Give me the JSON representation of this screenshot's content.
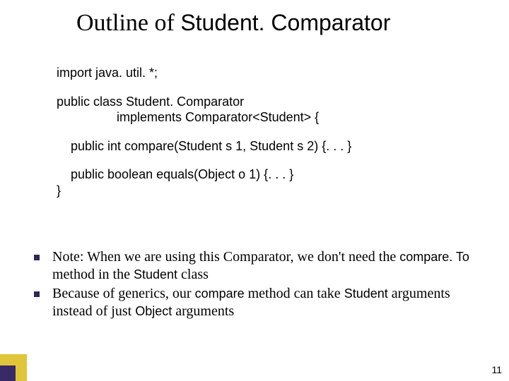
{
  "title": {
    "prefix": "Outline of ",
    "code": "Student. Comparator"
  },
  "code": {
    "l1": "import java. util. *;",
    "l2": "public class Student. Comparator",
    "l3": "                 implements Comparator<Student> {",
    "l4": "    public int compare(Student s 1, Student s 2) {. . . }",
    "l5": "    public boolean equals(Object o 1) {. . . }",
    "l6": "}"
  },
  "notes": {
    "n1a": "Note: When we are using this Comparator, we don't need the ",
    "n1b": "compare. To",
    "n1c": " method in the ",
    "n1d": "Student",
    "n1e": " class",
    "n2a": "Because of generics, our ",
    "n2b": "compare",
    "n2c": " method can take ",
    "n2d": "Student",
    "n2e": " arguments instead of just ",
    "n2f": "Object",
    "n2g": " arguments"
  },
  "page": "11"
}
